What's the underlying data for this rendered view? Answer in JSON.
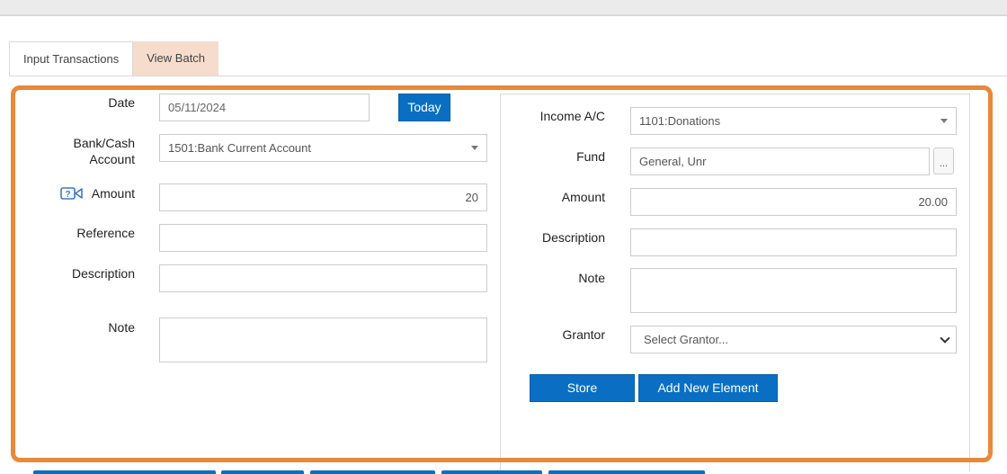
{
  "tabs": [
    {
      "label": "Input Transactions"
    },
    {
      "label": "View Batch"
    }
  ],
  "left_form": {
    "date_label": "Date",
    "date_value": "05/11/2024",
    "today_button": "Today",
    "bank_label_line1": "Bank/Cash",
    "bank_label_line2": "Account",
    "bank_value": "1501:Bank Current Account",
    "amount_label": "Amount",
    "amount_value": "20",
    "reference_label": "Reference",
    "reference_value": "",
    "description_label": "Description",
    "description_value": "",
    "note_label": "Note",
    "note_value": ""
  },
  "right_form": {
    "income_label": "Income A/C",
    "income_value": "1101:Donations",
    "fund_label": "Fund",
    "fund_value": "General, Unr",
    "fund_lookup_button": "...",
    "amount_label": "Amount",
    "amount_value": "20.00",
    "description_label": "Description",
    "description_value": "",
    "note_label": "Note",
    "note_value": "",
    "grantor_label": "Grantor",
    "grantor_placeholder": "Select Grantor...",
    "store_button": "Store",
    "add_new_button": "Add New Element"
  },
  "colors": {
    "highlight": "#e8893a",
    "primary_button": "#0a6fc2",
    "inactive_tab": "#f5dccc"
  },
  "icons": {
    "amount_help": "video-help-icon",
    "select_arrow": "caret-down-icon",
    "grantor_arrow": "chevron-down-icon"
  }
}
